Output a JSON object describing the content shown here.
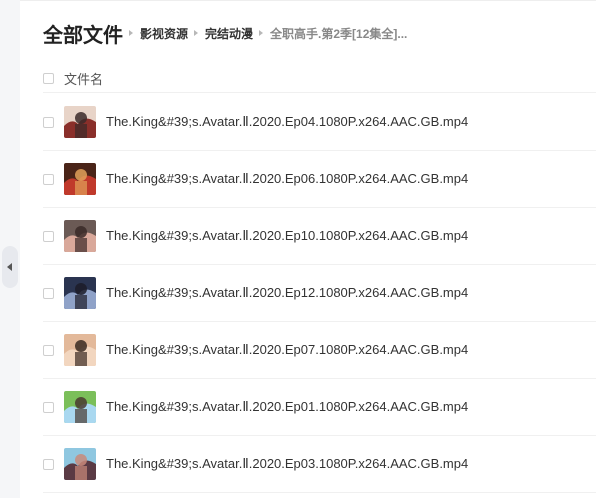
{
  "breadcrumb": {
    "root": "全部文件",
    "items": [
      "影视资源",
      "完结动漫",
      "全职高手.第2季[12集全]..."
    ]
  },
  "list_header": {
    "name_label": "文件名"
  },
  "files": [
    {
      "name": "The.King&#39;s.Avatar.Ⅱ.2020.Ep04.1080P.x264.AAC.GB.mp4",
      "thumb_colors": [
        "#e8d4c8",
        "#8a2f2a",
        "#3b2a2a"
      ]
    },
    {
      "name": "The.King&#39;s.Avatar.Ⅱ.2020.Ep06.1080P.x264.AAC.GB.mp4",
      "thumb_colors": [
        "#4a2418",
        "#c0392b",
        "#e2a15a"
      ]
    },
    {
      "name": "The.King&#39;s.Avatar.Ⅱ.2020.Ep10.1080P.x264.AAC.GB.mp4",
      "thumb_colors": [
        "#6b5a55",
        "#d9a89a",
        "#3a2a28"
      ]
    },
    {
      "name": "The.King&#39;s.Avatar.Ⅱ.2020.Ep12.1080P.x264.AAC.GB.mp4",
      "thumb_colors": [
        "#2a3450",
        "#8fa2c8",
        "#1c1c28"
      ]
    },
    {
      "name": "The.King&#39;s.Avatar.Ⅱ.2020.Ep07.1080P.x264.AAC.GB.mp4",
      "thumb_colors": [
        "#e3b99a",
        "#f2d6bf",
        "#3a2a22"
      ]
    },
    {
      "name": "The.King&#39;s.Avatar.Ⅱ.2020.Ep01.1080P.x264.AAC.GB.mp4",
      "thumb_colors": [
        "#7bbf5a",
        "#a9d8f0",
        "#4a3a30"
      ]
    },
    {
      "name": "The.King&#39;s.Avatar.Ⅱ.2020.Ep03.1080P.x264.AAC.GB.mp4",
      "thumb_colors": [
        "#8fc7e0",
        "#5a3a44",
        "#c98a7a"
      ]
    }
  ]
}
